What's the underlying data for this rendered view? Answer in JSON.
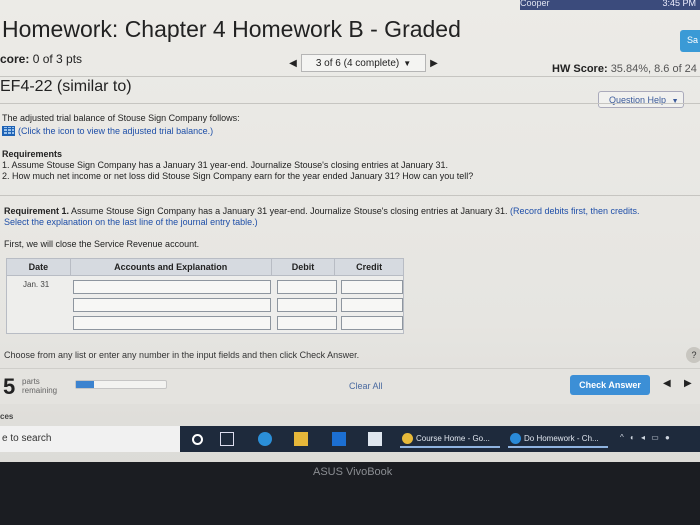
{
  "system": {
    "user": "Cooper",
    "clock": "3:45 PM"
  },
  "header": {
    "title": "Homework: Chapter 4 Homework B - Graded",
    "save_label": "Sa",
    "score_label": "core:",
    "score_value": "0 of 3 pts",
    "nav_position": "3 of 6 (4 complete)",
    "hw_score_label": "HW Score:",
    "hw_score_value": "35.84%, 8.6 of 24"
  },
  "question": {
    "id": "EF4-22 (similar to)",
    "help_label": "Question Help",
    "intro": "The adjusted trial balance of Stouse Sign Company follows:",
    "icon_hint": "(Click the icon to view the adjusted trial balance.)",
    "requirements_heading": "Requirements",
    "req1": "1. Assume Stouse Sign Company has a January 31 year-end. Journalize Stouse's closing entries at January 31.",
    "req2": "2. How much net income or net loss did Stouse Sign Company earn for the year ended January 31? How can you tell?"
  },
  "task": {
    "label": "Requirement 1.",
    "text": " Assume Stouse Sign Company has a January 31 year-end. Journalize Stouse's closing entries at January 31. ",
    "note1": "(Record debits first, then credits.",
    "note2": "Select the explanation on the last line of the journal entry table.)",
    "first_step": "First, we will close the Service Revenue account."
  },
  "journal": {
    "headers": {
      "date": "Date",
      "accounts": "Accounts and Explanation",
      "debit": "Debit",
      "credit": "Credit"
    },
    "date": "Jan. 31"
  },
  "footer": {
    "instructions": "Choose from any list or enter any number in the input fields and then click Check Answer.",
    "help_glyph": "?",
    "parts_count": "5",
    "parts_word": "parts",
    "remaining_word": "remaining",
    "progress": 0.2,
    "clear_label": "Clear All",
    "check_label": "Check Answer"
  },
  "bottom_label": "ces",
  "taskbar": {
    "search_text": "e to search",
    "app1": "Course Home - Go...",
    "app2": "Do Homework - Ch..."
  },
  "laptop_brand": "ASUS VivoBook",
  "colors": {
    "accent": "#3c8fd6",
    "link": "#1f4fa8",
    "taskbar": "#1e2a3c"
  }
}
